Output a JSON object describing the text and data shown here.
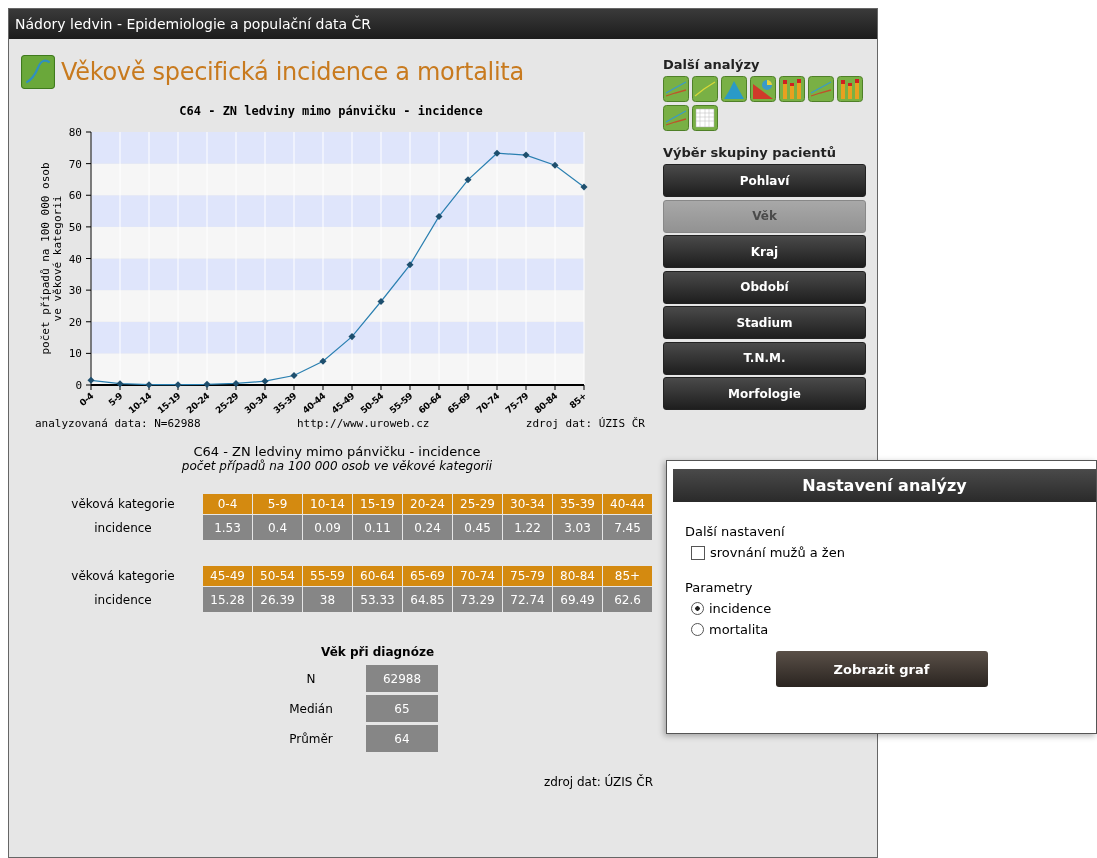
{
  "window": {
    "title": "Nádory ledvin - Epidemiologie a populační data ČR"
  },
  "page_title": "Věkově specifická incidence a mortalita",
  "chart": {
    "footer_left": "analyzovaná data: N=62988",
    "footer_center": "http://www.uroweb.cz",
    "footer_right": "zdroj dat: ÚZIS ČR",
    "chart_data": {
      "type": "line",
      "title": "C64 - ZN ledviny mimo pánvičku - incidence",
      "ylabel": "počet případů na 100 000 osob ve věkové kategorii",
      "categories": [
        "0-4",
        "5-9",
        "10-14",
        "15-19",
        "20-24",
        "25-29",
        "30-34",
        "35-39",
        "40-44",
        "45-49",
        "50-54",
        "55-59",
        "60-64",
        "65-69",
        "70-74",
        "75-79",
        "80-84",
        "85+"
      ],
      "ylim": [
        0,
        80
      ],
      "yticks": [
        0,
        10,
        20,
        30,
        40,
        50,
        60,
        70,
        80
      ],
      "grid": true,
      "series": [
        {
          "color": "#2a7fb0",
          "marker": "diamond",
          "values": [
            1.5,
            0.4,
            0.1,
            0.1,
            0.2,
            0.5,
            1.2,
            3,
            7.5,
            15.3,
            26.4,
            38,
            53.3,
            64.9,
            73.3,
            72.7,
            69.5,
            62.6
          ]
        }
      ]
    }
  },
  "table": {
    "title": "C64 - ZN ledviny mimo pánvičku - incidence",
    "subtitle": "počet případů na 100 000 osob ve věkové kategorii",
    "blocks": [
      {
        "header_label": "věková kategorie",
        "value_label": "incidence",
        "categories": [
          "0-4",
          "5-9",
          "10-14",
          "15-19",
          "20-24",
          "25-29",
          "30-34",
          "35-39",
          "40-44"
        ],
        "values": [
          "1.53",
          "0.4",
          "0.09",
          "0.11",
          "0.24",
          "0.45",
          "1.22",
          "3.03",
          "7.45"
        ]
      },
      {
        "header_label": "věková kategorie",
        "value_label": "incidence",
        "categories": [
          "45-49",
          "50-54",
          "55-59",
          "60-64",
          "65-69",
          "70-74",
          "75-79",
          "80-84",
          "85+"
        ],
        "values": [
          "15.28",
          "26.39",
          "38",
          "53.33",
          "64.85",
          "73.29",
          "72.74",
          "69.49",
          "62.6"
        ]
      }
    ]
  },
  "age_stats": {
    "title": "Věk při diagnóze",
    "rows": [
      {
        "label": "N",
        "value": "62988"
      },
      {
        "label": "Medián",
        "value": "65"
      },
      {
        "label": "Průměr",
        "value": "64"
      }
    ],
    "source": "zdroj dat: ÚZIS ČR"
  },
  "sidebar": {
    "analyses_title": "Další analýzy",
    "analyses": [
      {
        "kind": "lines"
      },
      {
        "kind": "line"
      },
      {
        "kind": "area"
      },
      {
        "kind": "pie"
      },
      {
        "kind": "bars"
      },
      {
        "kind": "lines"
      },
      {
        "kind": "bars"
      },
      {
        "kind": "lines"
      },
      {
        "kind": "table"
      }
    ],
    "groups_title": "Výběr skupiny pacientů",
    "groups": [
      {
        "label": "Pohlaví",
        "disabled": false
      },
      {
        "label": "Věk",
        "disabled": true
      },
      {
        "label": "Kraj",
        "disabled": false
      },
      {
        "label": "Období",
        "disabled": false
      },
      {
        "label": "Stadium",
        "disabled": false
      },
      {
        "label": "T.N.M.",
        "disabled": false
      },
      {
        "label": "Morfologie",
        "disabled": false
      }
    ]
  },
  "dialog": {
    "title": "Nastavení analýzy",
    "settings_title": "Další nastavení",
    "checkbox": {
      "label": "srovnání mužů a žen",
      "checked": false
    },
    "params_title": "Parametry",
    "params": [
      {
        "label": "incidence",
        "selected": true
      },
      {
        "label": "mortalita",
        "selected": false
      }
    ],
    "button": "Zobrazit graf"
  }
}
